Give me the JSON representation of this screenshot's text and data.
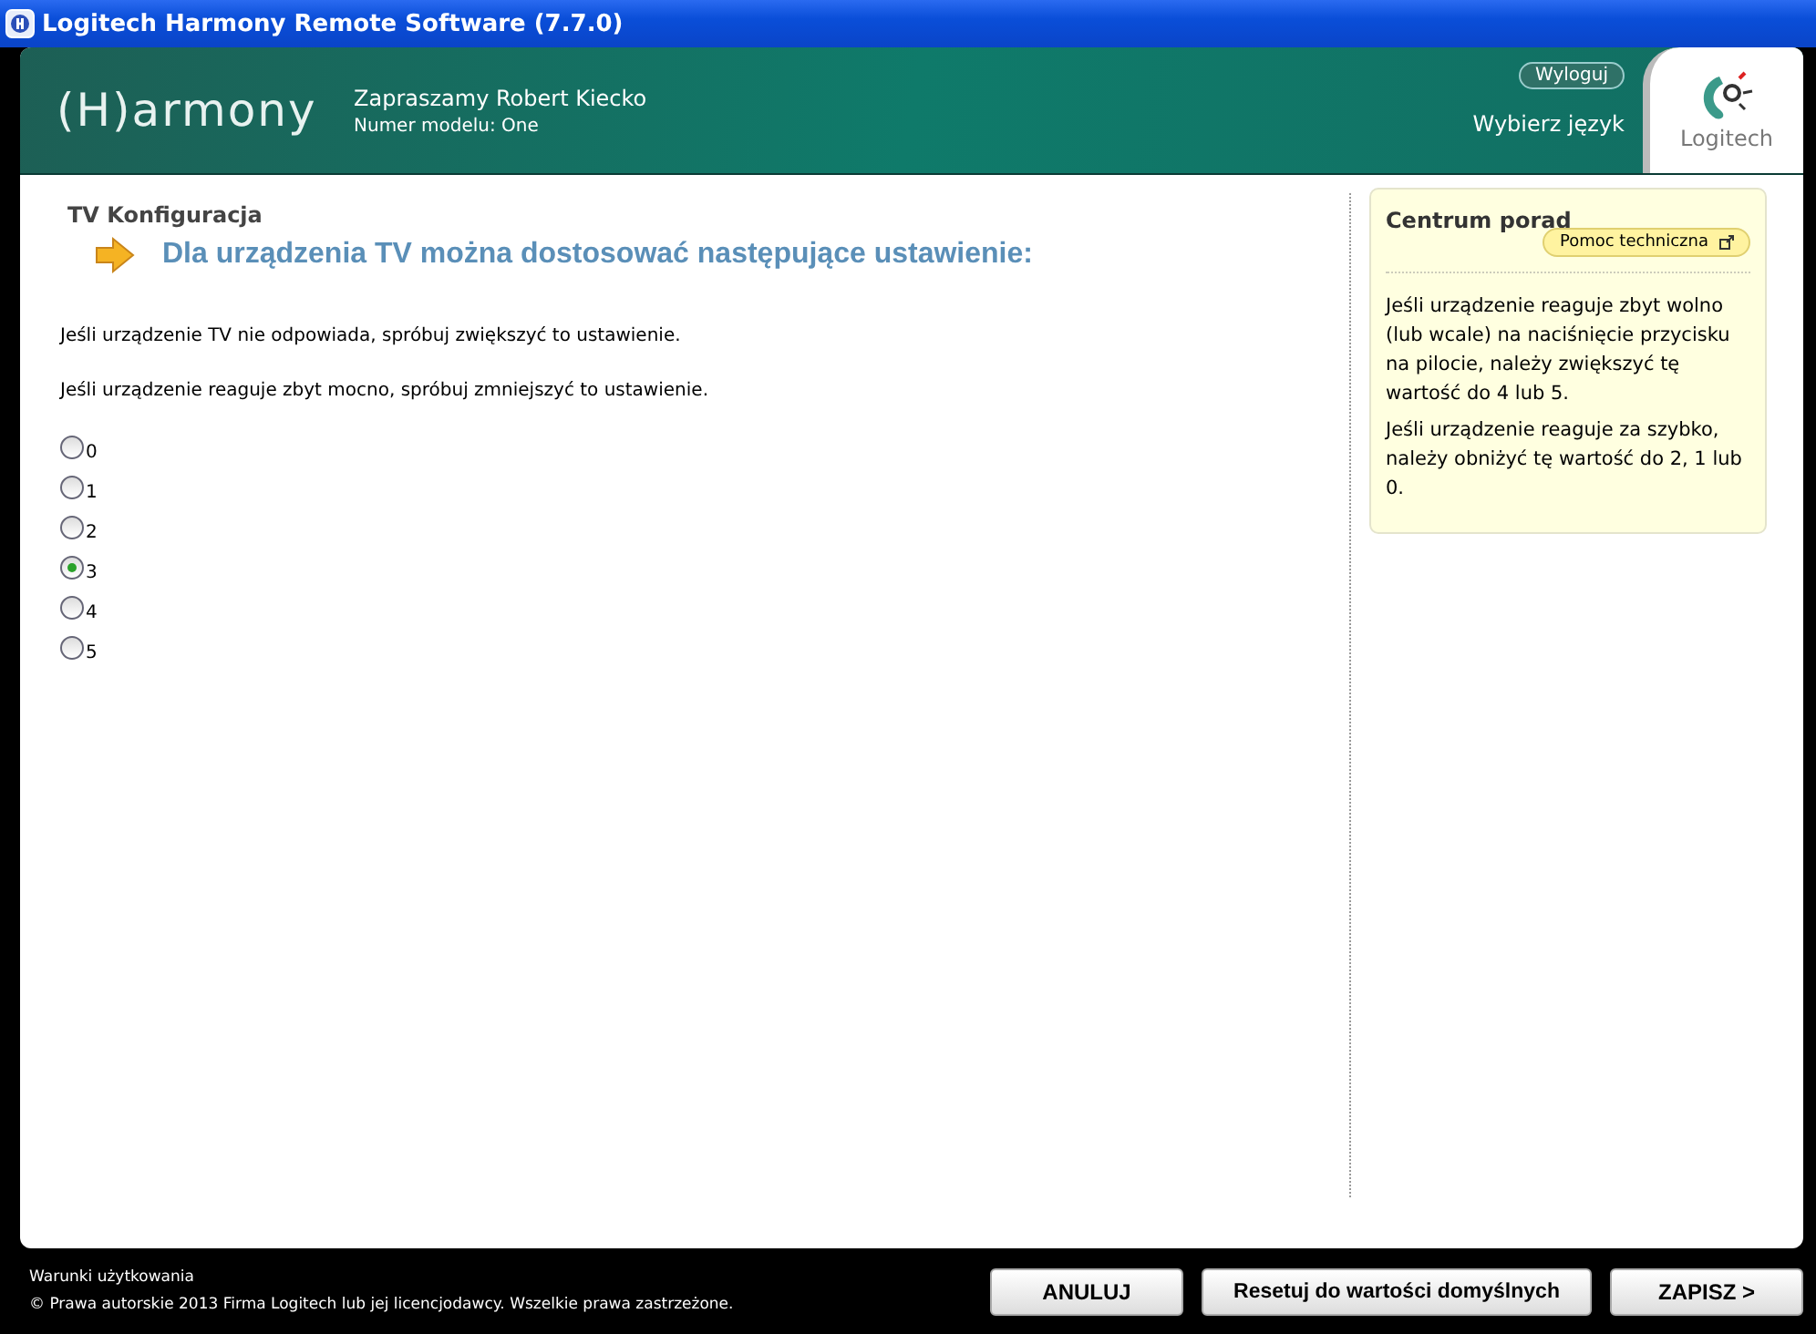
{
  "window": {
    "title": "Logitech Harmony Remote Software (7.7.0)"
  },
  "header": {
    "logo": "(H)armony",
    "welcome": "Zapraszamy Robert Kiecko",
    "model": "Numer modelu: One",
    "logout": "Wyloguj",
    "language": "Wybierz język",
    "brand": "Logitech"
  },
  "section": "TV Konfiguracja",
  "heading": "Dla urządzenia TV można dostosować następujące ustawienie:",
  "paragraphs": [
    "Jeśli urządzenie TV nie odpowiada, spróbuj zwiększyć to ustawienie.",
    "Jeśli urządzenie reaguje zbyt mocno, spróbuj zmniejszyć to ustawienie."
  ],
  "options": [
    {
      "label": "0",
      "selected": false
    },
    {
      "label": "1",
      "selected": false
    },
    {
      "label": "2",
      "selected": false
    },
    {
      "label": "3",
      "selected": true
    },
    {
      "label": "4",
      "selected": false
    },
    {
      "label": "5",
      "selected": false
    }
  ],
  "tips": {
    "title": "Centrum porad",
    "help": "Pomoc techniczna",
    "paragraphs": [
      "Jeśli urządzenie reaguje zbyt wolno (lub wcale) na naciśnięcie przycisku na pilocie, należy zwiększyć tę wartość do 4 lub 5.",
      "Jeśli urządzenie reaguje za szybko, należy obniżyć tę wartość do 2, 1 lub 0."
    ]
  },
  "footer": {
    "terms": "Warunki użytkowania",
    "copyright": "© Prawa autorskie 2013 Firma Logitech lub jej licencjodawcy. Wszelkie prawa zastrzeżone.",
    "buttons": [
      "ANULUJ",
      "Resetuj do wartości domyślnych",
      "ZAPISZ >"
    ]
  }
}
